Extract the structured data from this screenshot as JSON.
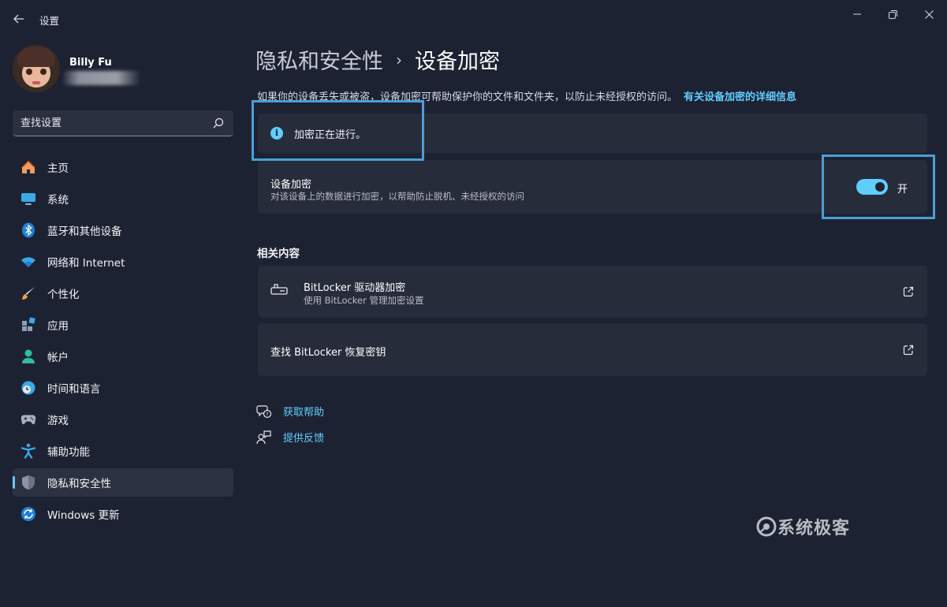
{
  "window": {
    "title": "设置",
    "back_icon": "arrow-left-icon",
    "controls": [
      "minimize-icon",
      "restore-icon",
      "close-icon"
    ]
  },
  "user": {
    "name": "Billy Fu",
    "email": ""
  },
  "search": {
    "placeholder": "查找设置",
    "icon": "search-icon"
  },
  "sidebar": {
    "items": [
      {
        "label": "主页",
        "icon": "home-icon",
        "active": false
      },
      {
        "label": "系统",
        "icon": "monitor-icon",
        "active": false
      },
      {
        "label": "蓝牙和其他设备",
        "icon": "bluetooth-icon",
        "active": false
      },
      {
        "label": "网络和 Internet",
        "icon": "wifi-icon",
        "active": false
      },
      {
        "label": "个性化",
        "icon": "brush-icon",
        "active": false
      },
      {
        "label": "应用",
        "icon": "apps-icon",
        "active": false
      },
      {
        "label": "帐户",
        "icon": "person-icon",
        "active": false
      },
      {
        "label": "时间和语言",
        "icon": "clock-globe-icon",
        "active": false
      },
      {
        "label": "游戏",
        "icon": "gamepad-icon",
        "active": false
      },
      {
        "label": "辅助功能",
        "icon": "accessibility-icon",
        "active": false
      },
      {
        "label": "隐私和安全性",
        "icon": "shield-icon",
        "active": true
      },
      {
        "label": "Windows 更新",
        "icon": "update-icon",
        "active": false
      }
    ]
  },
  "breadcrumb": {
    "parent": "隐私和安全性",
    "separator": "›",
    "current": "设备加密"
  },
  "description": {
    "text": "如果你的设备丢失或被盗，设备加密可帮助保护你的文件和文件夹，以防止未经授权的访问。",
    "link": "有关设备加密的详细信息"
  },
  "info_banner": {
    "icon": "info-icon",
    "glyph": "i",
    "text": "加密正在进行。"
  },
  "device_encryption": {
    "title": "设备加密",
    "subtitle": "对该设备上的数据进行加密，以帮助防止脱机、未经授权的访问",
    "toggle_state": true,
    "toggle_label": "开"
  },
  "related": {
    "heading": "相关内容",
    "items": [
      {
        "title": "BitLocker 驱动器加密",
        "subtitle": "使用 BitLocker 管理加密设置",
        "icon": "drive-key-icon",
        "action_icon": "external-link-icon"
      },
      {
        "title": "查找 BitLocker 恢复密钥",
        "subtitle": "",
        "action_icon": "external-link-icon"
      }
    ]
  },
  "help_links": [
    {
      "label": "获取帮助",
      "icon": "help-chat-icon"
    },
    {
      "label": "提供反馈",
      "icon": "feedback-icon"
    }
  ],
  "watermark": {
    "text": "系统极客"
  },
  "colors": {
    "background": "#1d2233",
    "card": "#272c3b",
    "accent": "#60cdff",
    "highlight_border": "#4a9fd8"
  }
}
